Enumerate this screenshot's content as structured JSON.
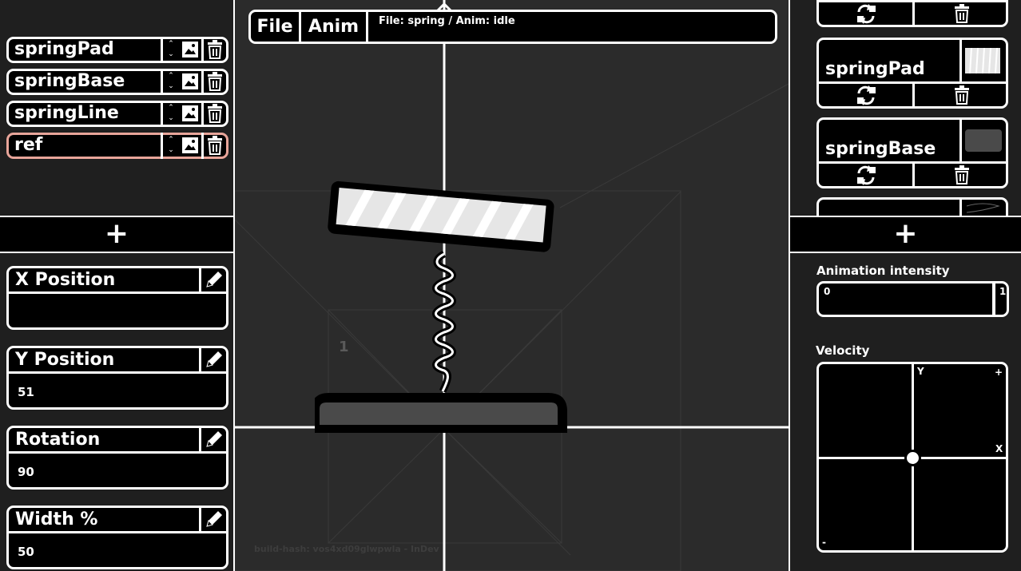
{
  "layers": [
    {
      "name": "springPad",
      "selected": false
    },
    {
      "name": "springBase",
      "selected": false
    },
    {
      "name": "springLine",
      "selected": false
    },
    {
      "name": "ref",
      "selected": true
    }
  ],
  "left_add_label": "+",
  "properties": [
    {
      "label": "X Position",
      "value": ""
    },
    {
      "label": "Y Position",
      "value": "51"
    },
    {
      "label": "Rotation",
      "value": "90"
    },
    {
      "label": "Width %",
      "value": "50"
    }
  ],
  "menubar": {
    "file_label": "File",
    "anim_label": "Anim",
    "status": "File: spring / Anim: idle"
  },
  "canvas": {
    "guide_number": "1",
    "build_hash": "build-hash: vos4xd09glwpwla - InDev"
  },
  "sprites": [
    {
      "name": ""
    },
    {
      "name": "springPad"
    },
    {
      "name": "springBase"
    },
    {
      "name": ""
    }
  ],
  "right_add_label": "+",
  "animation_intensity": {
    "label": "Animation intensity",
    "min_label": "0",
    "max_label": "1",
    "value": 0.91
  },
  "velocity": {
    "label": "Velocity",
    "y_label": "Y",
    "x_label": "X",
    "plus_label": "+",
    "minus_label": "-",
    "x": 0,
    "y": 0
  },
  "colors": {
    "panel": "#1f1f1f",
    "canvas": "#2b2b2b",
    "selected_outline": "#e8a59a",
    "spring_base_fill": "#4a4a4a"
  }
}
